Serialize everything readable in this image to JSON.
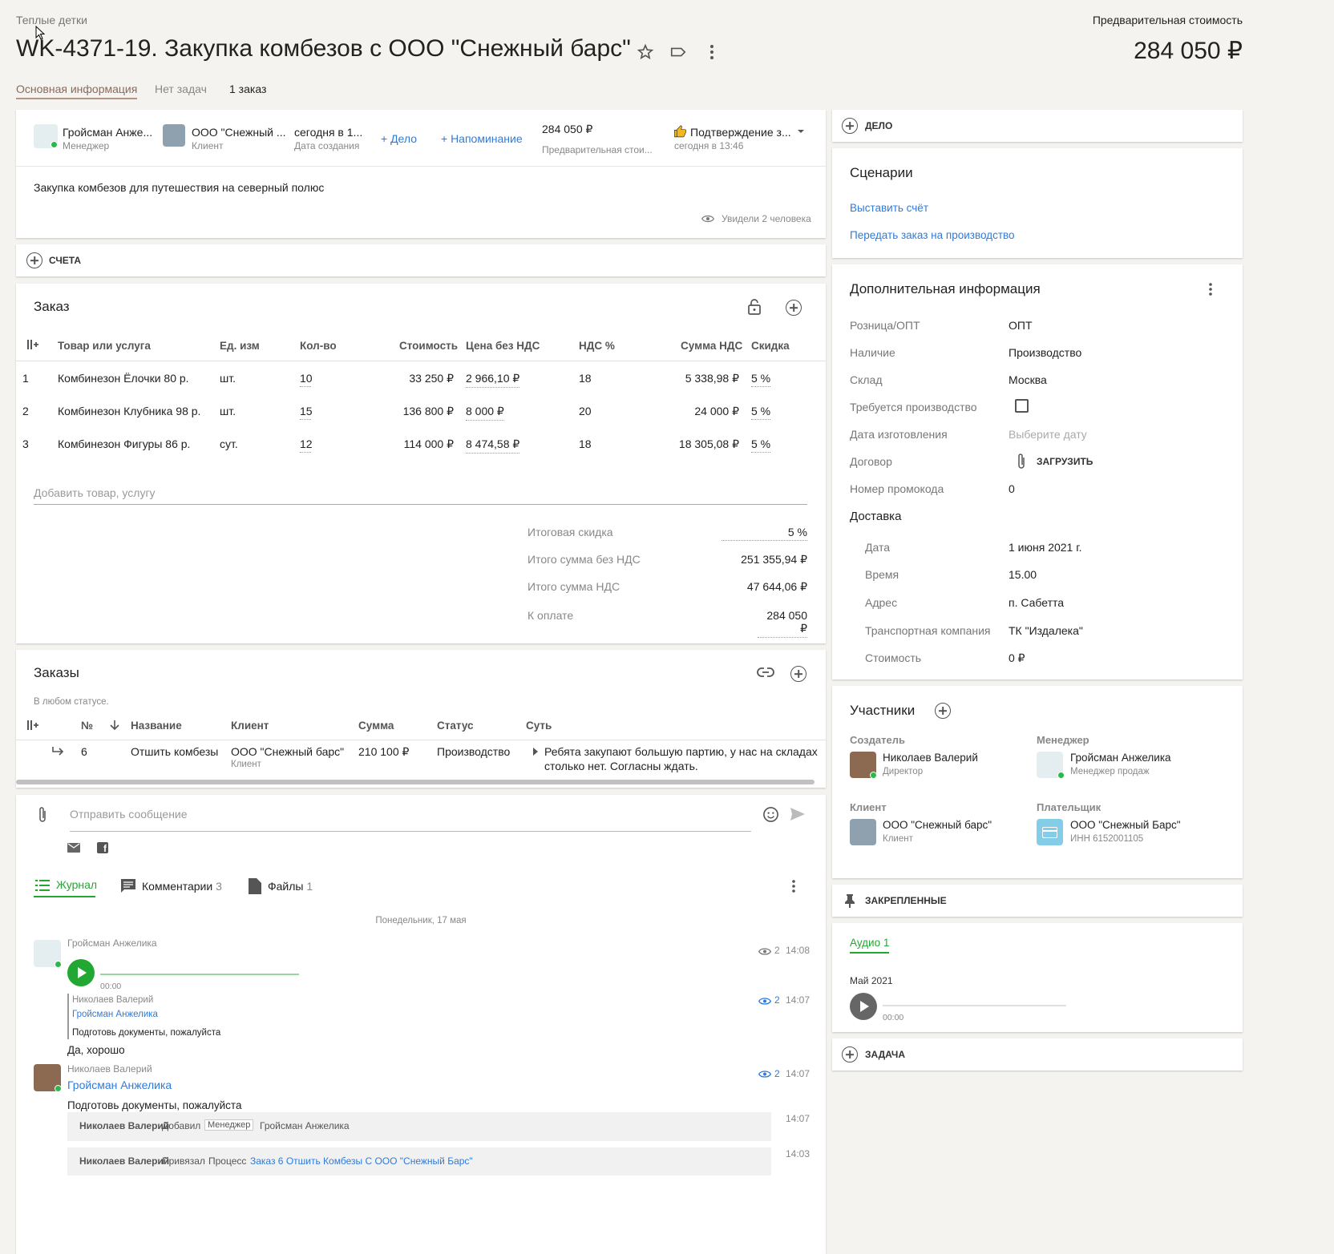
{
  "header": {
    "breadcrumb": "Теплые детки",
    "title": "WK-4371-19. Закупка комбезов с ООО \"Снежный барс\"",
    "price_label": "Предварительная стоимость",
    "price_value": "284 050 ₽"
  },
  "tabs": [
    {
      "label": "Основная информация"
    },
    {
      "label": "Нет задач"
    },
    {
      "label": "1 заказ"
    }
  ],
  "summary": {
    "manager_name": "Гройсман Анже...",
    "manager_role": "Менеджер",
    "client_name": "ООО \"Снежный ...",
    "client_role": "Клиент",
    "created_value": "сегодня в 1...",
    "created_label": "Дата создания",
    "add_deal": "+ Дело",
    "add_reminder": "+ Напоминание",
    "price_value": "284 050 ₽",
    "price_label": "Предварительная стои...",
    "stage_name": "Подтверждение з...",
    "stage_time": "сегодня в 13:46",
    "description": "Закупка комбезов для путешествия на северный полюс",
    "seen": "Увидели 2 человека"
  },
  "accounts_label": "СЧЕТА",
  "order": {
    "title": "Заказ",
    "columns": [
      "Товар или услуга",
      "Ед. изм",
      "Кол-во",
      "Стоимость",
      "Цена без НДС",
      "НДС %",
      "Сумма НДС",
      "Скидка"
    ],
    "rows": [
      {
        "n": "1",
        "name": "Комбинезон Ёлочки 80 р.",
        "unit": "шт.",
        "qty": "10",
        "cost": "33 250 ₽",
        "price": "2 966,10 ₽",
        "vat": "18",
        "vat_sum": "5 338,98 ₽",
        "disc": "5 %"
      },
      {
        "n": "2",
        "name": "Комбинезон Клубника 98 р.",
        "unit": "шт.",
        "qty": "15",
        "cost": "136 800 ₽",
        "price": "8 000 ₽",
        "vat": "20",
        "vat_sum": "24 000 ₽",
        "disc": "5 %"
      },
      {
        "n": "3",
        "name": "Комбинезон Фигуры 86 р.",
        "unit": "сут.",
        "qty": "12",
        "cost": "114 000 ₽",
        "price": "8 474,58 ₽",
        "vat": "18",
        "vat_sum": "18 305,08 ₽",
        "disc": "5 %"
      }
    ],
    "add_placeholder": "Добавить товар, услугу",
    "totals": [
      {
        "label": "Итоговая скидка",
        "value": "5 %"
      },
      {
        "label": "Итого сумма без НДС",
        "value": "251 355,94 ₽"
      },
      {
        "label": "Итого сумма НДС",
        "value": "47 644,06 ₽"
      },
      {
        "label": "К оплате",
        "value": "284 050 ₽"
      }
    ]
  },
  "orders": {
    "title": "Заказы",
    "filter": "В любом статусе.",
    "columns": [
      "№",
      "Название",
      "Клиент",
      "Сумма",
      "Статус",
      "Суть"
    ],
    "row": {
      "num": "6",
      "name": "Отшить комбезы",
      "client": "ООО \"Снежный барс\"",
      "client_role": "Клиент",
      "sum": "210 100 ₽",
      "status": "Производство",
      "essence_1": "Ребята закупают большую партию, у нас на складах",
      "essence_2": "столько нет. Согласны ждать."
    }
  },
  "chat": {
    "placeholder": "Отправить сообщение",
    "tabs": [
      {
        "label": "Журнал",
        "count": ""
      },
      {
        "label": "Комментарии",
        "count": "3"
      },
      {
        "label": "Файлы",
        "count": "1"
      }
    ],
    "date": "Понедельник, 17 мая",
    "msg1": {
      "author": "Гройсман Анжелика",
      "audio_time": "00:00",
      "views": "2",
      "time": "14:08"
    },
    "quote": {
      "author": "Николаев Валерий",
      "mention": "Гройсман Анжелика",
      "text": "Подготовь документы, пожалуйста",
      "views": "2",
      "time": "14:07"
    },
    "reply": "Да, хорошо",
    "msg2": {
      "author": "Николаев Валерий",
      "mention": "Гройсман Анжелика",
      "text": "Подготовь документы, пожалуйста",
      "views": "2",
      "time": "14:07"
    },
    "sys1": {
      "actor": "Николаев Валерий",
      "action": "Добавил",
      "role": "Менеджер",
      "target": "Гройсман Анжелика",
      "time": "14:07"
    },
    "sys2": {
      "actor": "Николаев Валерий",
      "action": "Привязал",
      "kind": "Процесс",
      "link": "Заказ 6 Отшить Комбезы С ООО \"Снежный Барс\"",
      "time": "14:03"
    }
  },
  "right": {
    "deal_label": "ДЕЛО",
    "scenarios_title": "Сценарии",
    "scenarios": [
      "Выставить счёт",
      "Передать заказ на производство"
    ],
    "extra_title": "Дополнительная информация",
    "extra_rows": [
      {
        "label": "Розница/ОПТ",
        "value": "ОПТ"
      },
      {
        "label": "Наличие",
        "value": "Производство"
      },
      {
        "label": "Склад",
        "value": "Москва"
      },
      {
        "label": "Требуется производство",
        "value": ""
      },
      {
        "label": "Дата изготовления",
        "value": "Выберите дату"
      },
      {
        "label": "Договор",
        "value": "ЗАГРУЗИТЬ"
      },
      {
        "label": "Номер промокода",
        "value": "0"
      }
    ],
    "delivery_title": "Доставка",
    "delivery_rows": [
      {
        "label": "Дата",
        "value": "1 июня 2021 г."
      },
      {
        "label": "Время",
        "value": "15.00"
      },
      {
        "label": "Адрес",
        "value": "п. Сабетта"
      },
      {
        "label": "Транспортная компания",
        "value": "ТК \"Издалека\""
      },
      {
        "label": "Стоимость",
        "value": "0 ₽"
      }
    ],
    "participants_title": "Участники",
    "creator_label": "Создатель",
    "creator_name": "Николаев Валерий",
    "creator_role": "Директор",
    "manager_label": "Менеджер",
    "manager_name": "Гройсман Анжелика",
    "manager_role": "Менеджер продаж",
    "client_label": "Клиент",
    "client_name": "ООО \"Снежный барс\"",
    "client_role": "Клиент",
    "payer_label": "Плательщик",
    "payer_name": "ООО \"Снежный Барс\"",
    "payer_inn": "ИНН 6152001105",
    "pinned_label": "ЗАКРЕПЛЕННЫЕ",
    "audio_tab": "Аудио 1",
    "audio_month": "Май 2021",
    "audio_time": "00:00",
    "task_label": "ЗАДАЧА"
  },
  "colors": {
    "accent_green": "#22a832",
    "link_blue": "#2f7bd9",
    "online": "#2db84d"
  },
  "icons": [
    "star-icon",
    "tag-icon",
    "more-vert-icon",
    "add-circle-icon",
    "eye-icon",
    "lock-open-icon",
    "link-icon",
    "attach-icon",
    "emoji-icon",
    "send-icon",
    "mail-icon",
    "facebook-icon",
    "list-icon",
    "comment-icon",
    "file-icon",
    "play-icon",
    "pin-icon",
    "thumb-up-icon"
  ]
}
